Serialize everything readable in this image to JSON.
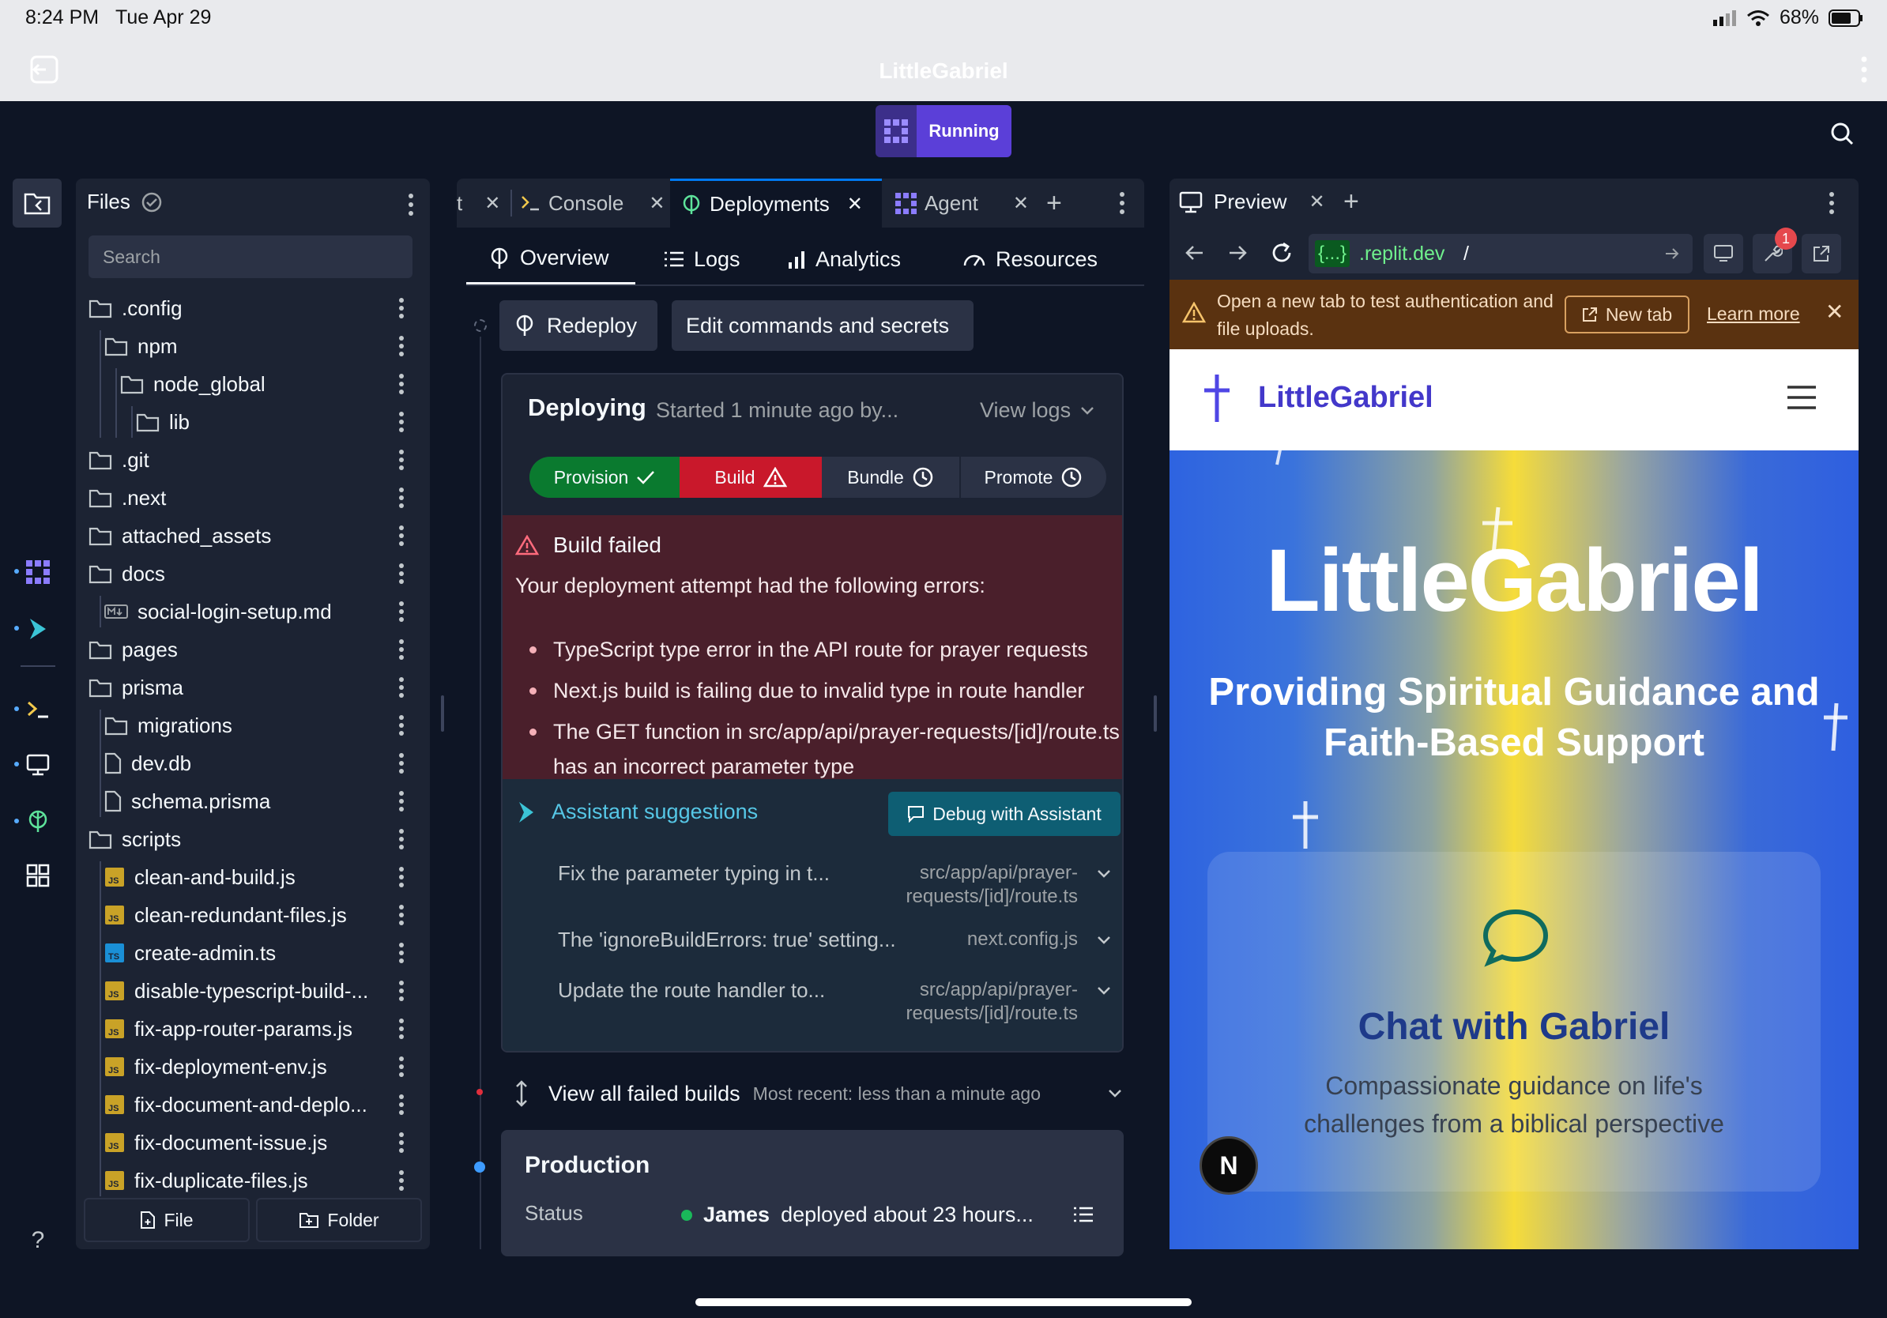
{
  "status_bar": {
    "time": "8:24 PM",
    "date": "Tue Apr 29",
    "battery": "68%"
  },
  "app": {
    "title": "LittleGabriel",
    "run_label": "Running"
  },
  "files": {
    "title": "Files",
    "search_placeholder": "Search",
    "items": [
      {
        "name": ".config",
        "type": "folder"
      },
      {
        "name": "npm",
        "type": "folder"
      },
      {
        "name": "node_global",
        "type": "folder"
      },
      {
        "name": "lib",
        "type": "folder"
      },
      {
        "name": ".git",
        "type": "folder"
      },
      {
        "name": ".next",
        "type": "folder"
      },
      {
        "name": "attached_assets",
        "type": "folder"
      },
      {
        "name": "docs",
        "type": "folder"
      },
      {
        "name": "social-login-setup.md",
        "type": "md"
      },
      {
        "name": "pages",
        "type": "folder"
      },
      {
        "name": "prisma",
        "type": "folder"
      },
      {
        "name": "migrations",
        "type": "folder"
      },
      {
        "name": "dev.db",
        "type": "file"
      },
      {
        "name": "schema.prisma",
        "type": "file"
      },
      {
        "name": "scripts",
        "type": "folder"
      },
      {
        "name": "clean-and-build.js",
        "type": "js"
      },
      {
        "name": "clean-redundant-files.js",
        "type": "js"
      },
      {
        "name": "create-admin.ts",
        "type": "ts"
      },
      {
        "name": "disable-typescript-build-...",
        "type": "js"
      },
      {
        "name": "fix-app-router-params.js",
        "type": "js"
      },
      {
        "name": "fix-deployment-env.js",
        "type": "js"
      },
      {
        "name": "fix-document-and-deplo...",
        "type": "js"
      },
      {
        "name": "fix-document-issue.js",
        "type": "js"
      },
      {
        "name": "fix-duplicate-files.js",
        "type": "js"
      }
    ],
    "file_button": "File",
    "folder_button": "Folder"
  },
  "mid": {
    "tabs": [
      {
        "label": "t"
      },
      {
        "label": "Console"
      },
      {
        "label": "Deployments"
      },
      {
        "label": "Agent"
      }
    ],
    "subtabs": [
      "Overview",
      "Logs",
      "Analytics",
      "Resources"
    ],
    "redeploy": "Redeploy",
    "edit_commands": "Edit commands and secrets",
    "deploying_title": "Deploying",
    "deploying_meta": "Started 1 minute ago by...",
    "view_logs": "View logs",
    "steps": [
      "Provision",
      "Build",
      "Bundle",
      "Promote"
    ],
    "build_failed_title": "Build failed",
    "build_failed_intro": "Your deployment attempt had the following errors:",
    "errors": [
      "TypeScript type error in the API route for prayer requests",
      "Next.js build is failing due to invalid type in route handler",
      "The GET function in src/app/api/prayer-requests/[id]/route.ts has an incorrect parameter type"
    ],
    "assistant_title": "Assistant suggestions",
    "debug_button": "Debug with Assistant",
    "suggestions": [
      {
        "text": "Fix the parameter typing in t...",
        "path": "src/app/api/prayer-requests/[id]/route.ts"
      },
      {
        "text": "The 'ignoreBuildErrors: true' setting...",
        "path": "next.config.js"
      },
      {
        "text": "Update the route handler to...",
        "path": "src/app/api/prayer-requests/[id]/route.ts"
      }
    ],
    "view_failed": "View all failed builds",
    "most_recent": "Most recent: less than a minute ago",
    "production_title": "Production",
    "status_label": "Status",
    "status_user": "James",
    "status_text": "deployed about 23 hours..."
  },
  "preview": {
    "tab_label": "Preview",
    "url_prefix": "{...}",
    "url_domain": ".replit.dev",
    "url_path": "/",
    "badge_count": "1",
    "warning_text": "Open a new tab to test authentication and file uploads.",
    "new_tab": "New tab",
    "learn_more": "Learn more",
    "site_name": "LittleGabriel",
    "hero_title": "LittleGabriel",
    "hero_subtitle": "Providing Spiritual Guidance and Faith-Based Support",
    "card_title": "Chat with Gabriel",
    "card_text": "Compassionate guidance on life's challenges from a biblical perspective",
    "next_badge": "N"
  },
  "colors": {
    "accent": "#0079f2",
    "running": "#5b3fd8",
    "provision": "#0a7a2f",
    "build": "#c9182b",
    "brand": "#4338ca"
  }
}
